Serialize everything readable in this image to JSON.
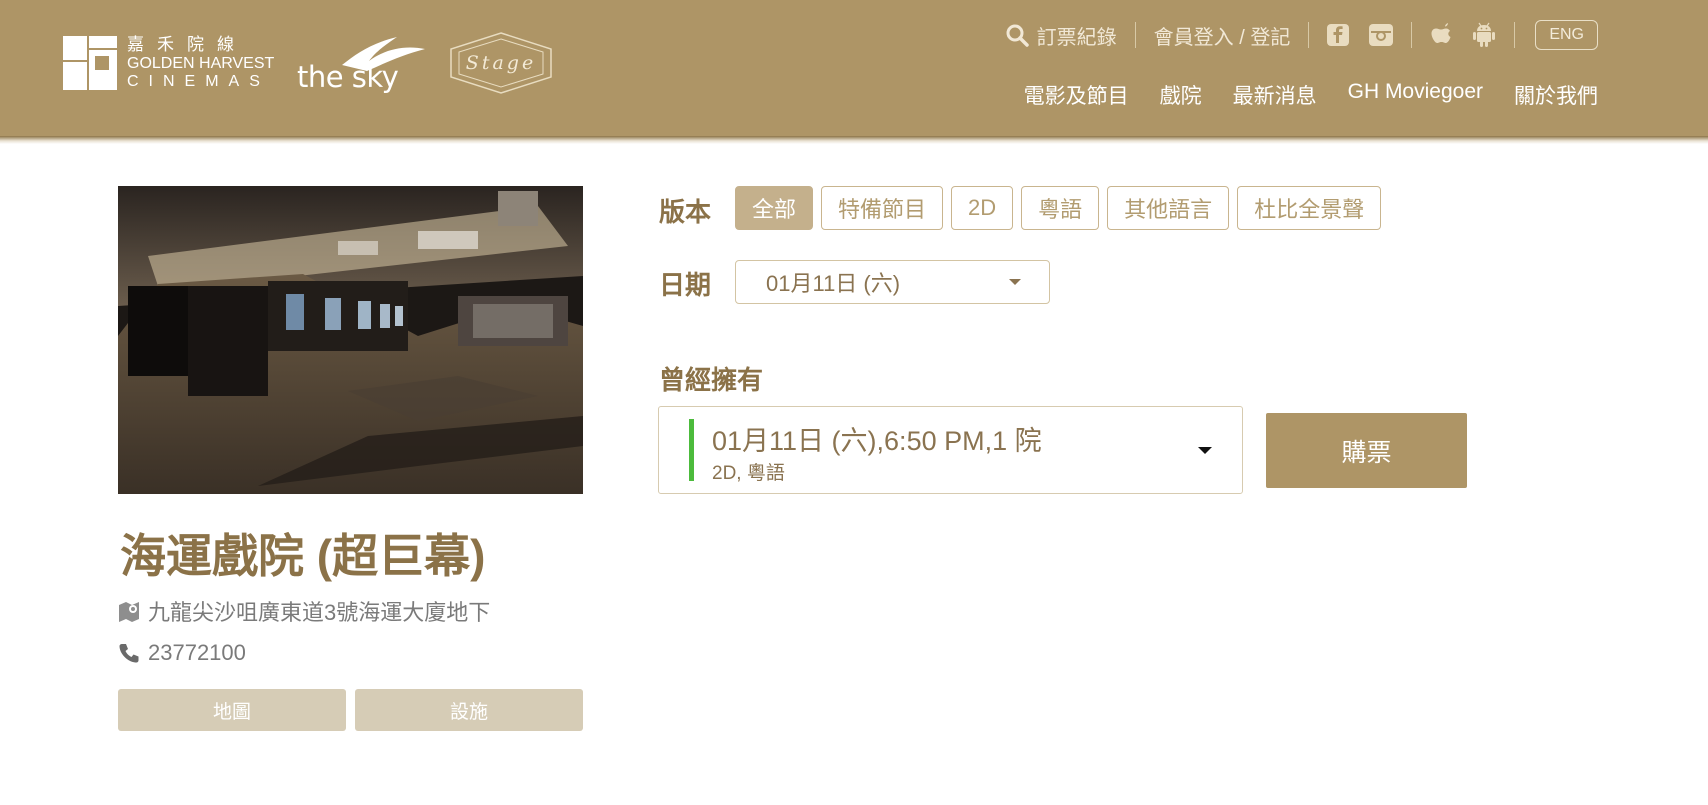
{
  "header": {
    "logo": {
      "zh": "嘉禾院線",
      "en_line1": "GOLDEN HARVEST",
      "en_line2": "CINEMAS"
    },
    "sky_logo": "the sky",
    "stage_logo": "Stage",
    "top_links": {
      "booking_record": "訂票紀錄",
      "member_login": "會員登入 / 登記",
      "lang": "ENG"
    },
    "nav": [
      "電影及節目",
      "戲院",
      "最新消息",
      "GH Moviegoer",
      "關於我們"
    ],
    "colors": {
      "header_bg": "#ae9566",
      "accent": "#8b7248"
    }
  },
  "cinema": {
    "name": "海運戲院 (超巨幕)",
    "address": "九龍尖沙咀廣東道3號海運大廈地下",
    "phone": "23772100",
    "map_button": "地圖",
    "facilities_button": "設施"
  },
  "filters": {
    "version_label": "版本",
    "versions": [
      "全部",
      "特備節目",
      "2D",
      "粵語",
      "其他語言",
      "杜比全景聲"
    ],
    "active_version": "全部",
    "date_label": "日期",
    "date_value": "01月11日 (六)"
  },
  "movie": {
    "title": "曾經擁有",
    "showtime_main": "01月11日 (六),6:50 PM,1 院",
    "showtime_sub": "2D, 粵語",
    "buy_button": "購票"
  }
}
